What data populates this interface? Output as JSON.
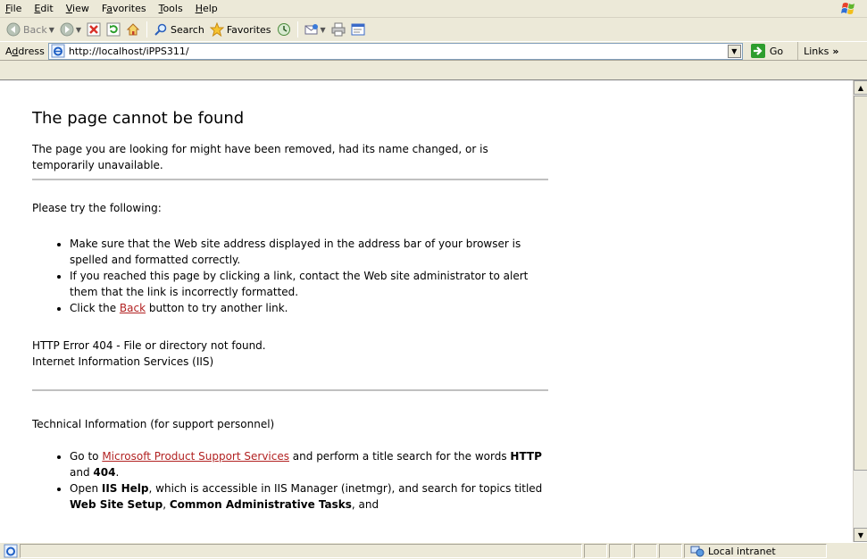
{
  "menu": {
    "items": [
      {
        "key": "F",
        "rest": "ile"
      },
      {
        "key": "E",
        "rest": "dit"
      },
      {
        "key": "V",
        "rest": "iew"
      },
      {
        "pre": "F",
        "key": "a",
        "rest": "vorites"
      },
      {
        "key": "T",
        "rest": "ools"
      },
      {
        "key": "H",
        "rest": "elp"
      }
    ]
  },
  "toolbar": {
    "back_label": "Back",
    "search_label": "Search",
    "favorites_label": "Favorites"
  },
  "address": {
    "label_pre": "A",
    "label_key": "d",
    "label_rest": "dress",
    "url": "http://localhost/iPPS311/",
    "go_label": "Go",
    "links_label": "Links",
    "links_chevron": "»"
  },
  "page": {
    "title": "The page cannot be found",
    "intro": "The page you are looking for might have been removed, had its name changed, or is temporarily unavailable.",
    "try_heading": "Please try the following:",
    "bullet1": "Make sure that the Web site address displayed in the address bar of your browser is spelled and formatted correctly.",
    "bullet2": "If you reached this page by clicking a link, contact the Web site administrator to alert them that the link is incorrectly formatted.",
    "bullet3_pre": "Click the ",
    "bullet3_link": "Back",
    "bullet3_post": " button to try another link.",
    "error_line": "HTTP Error 404 - File or directory not found.",
    "server_line": "Internet Information Services (IIS)",
    "tech_heading": "Technical Information (for support personnel)",
    "tech1_pre": "Go to ",
    "tech1_link": "Microsoft Product Support Services",
    "tech1_mid": " and perform a title search for the words ",
    "tech1_b1": "HTTP",
    "tech1_and": " and ",
    "tech1_b2": "404",
    "tech1_end": ".",
    "tech2_pre": "Open ",
    "tech2_b1": "IIS Help",
    "tech2_mid": ", which is accessible in IIS Manager (inetmgr), and search for topics titled ",
    "tech2_b2": "Web Site Setup",
    "tech2_comma": ", ",
    "tech2_b3": "Common Administrative Tasks",
    "tech2_end": ", and"
  },
  "status": {
    "zone_label": "Local intranet"
  },
  "colors": {
    "link": "#b22222",
    "chrome": "#ece9d8",
    "go_green": "#2e9e2e"
  }
}
